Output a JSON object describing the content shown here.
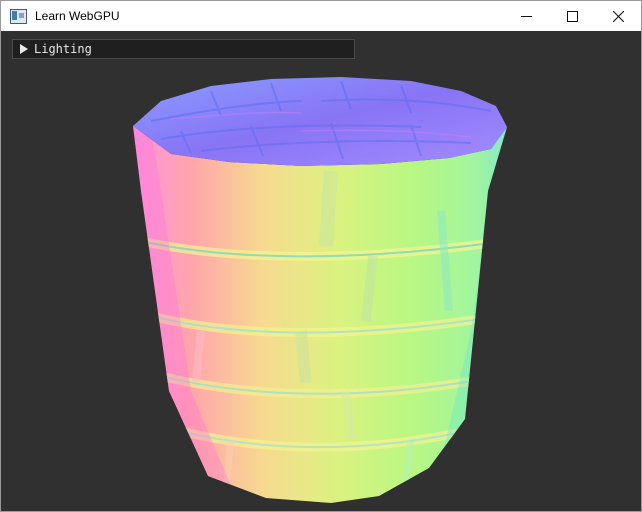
{
  "window": {
    "title": "Learn WebGPU",
    "controls": [
      "minimize",
      "maximize",
      "close"
    ]
  },
  "gui": {
    "panel_label": "Lighting",
    "panel_collapsed": true
  },
  "scene": {
    "object": "normal-mapped cylinder",
    "background_color": "#303030"
  },
  "icons": {
    "app": "app-window-icon",
    "collapse": "collapse-arrow-icon",
    "minimize": "minimize-icon",
    "maximize": "maximize-icon",
    "close": "close-icon"
  }
}
